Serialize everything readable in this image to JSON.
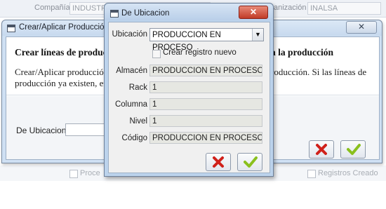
{
  "background": {
    "compania_label": "Compañía",
    "compania_value": "INDUSTRIAS INTEGRADAS DE ALIMENTOS",
    "organizacion_label": "anización",
    "organizacion_value": "INALSA",
    "check1_label": "Proce",
    "check2_label": "Registros Creado"
  },
  "main_dialog": {
    "title": "Crear/Aplicar Producción",
    "close_icon": "✕",
    "heading_left": "Crear líneas de producció",
    "heading_right": "a la producción",
    "desc_left_1": "Crear/Aplicar producción g",
    "desc_left_2": "producción ya existen, ente",
    "desc_right_1": "roducción. Si las líneas de",
    "ubicacion_label": "De Ubicacion",
    "ubicacion_value": "",
    "cancel_icon": "cross-icon",
    "ok_icon": "check-icon"
  },
  "ubic_dialog": {
    "title": "De Ubicacion",
    "close_icon": "✕",
    "ubicacion_label": "Ubicación",
    "ubicacion_value": "PRODUCCION EN PROCESO",
    "crear_registro_label": "Crear registro nuevo",
    "fields": [
      {
        "label": "Almacén",
        "value": "PRODUCCION EN PROCESO"
      },
      {
        "label": "Rack",
        "value": "1"
      },
      {
        "label": "Columna",
        "value": "1"
      },
      {
        "label": "Nivel",
        "value": "1"
      },
      {
        "label": "Código",
        "value": "PRODUCCION EN PROCESO"
      }
    ],
    "cancel_icon": "cross-icon",
    "ok_icon": "check-icon"
  },
  "colors": {
    "cancel_red": "#d0211b",
    "ok_green": "#8ac01e"
  }
}
